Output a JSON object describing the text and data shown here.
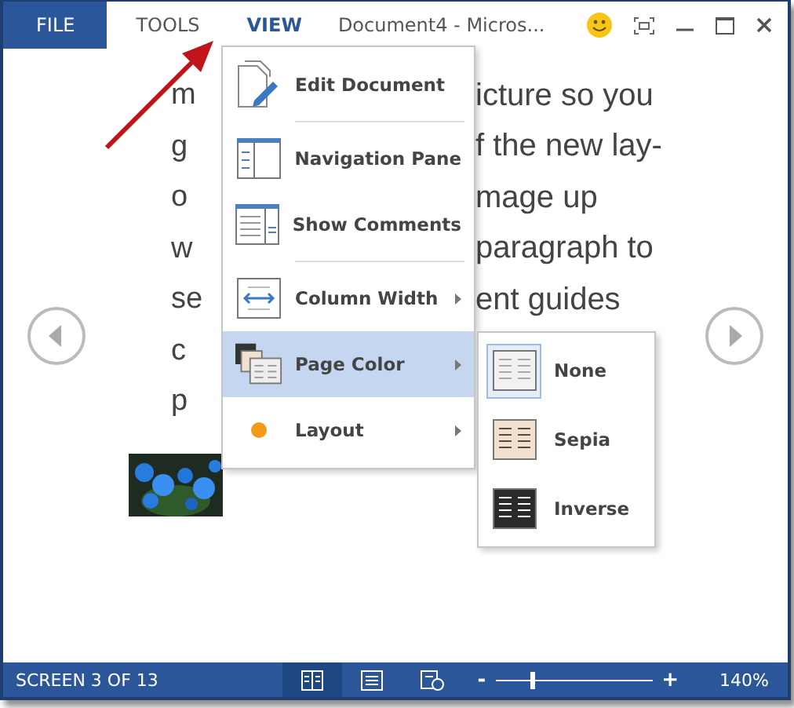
{
  "header": {
    "tabs": [
      {
        "label": "FILE",
        "kind": "file",
        "selected": false
      },
      {
        "label": "TOOLS",
        "kind": "menu",
        "selected": false
      },
      {
        "label": "VIEW",
        "kind": "menu",
        "selected": true
      }
    ],
    "title": "Document4 - Micros..."
  },
  "document": {
    "lines": [
      {
        "left": "m",
        "right": "icture so you"
      },
      {
        "left": "g",
        "right": "f the new lay-"
      },
      {
        "left": "o",
        "right": "mage up"
      },
      {
        "left": "w",
        "right": "paragraph to"
      },
      {
        "left": "se",
        "right": "ent guides"
      },
      {
        "left": "c"
      },
      {
        "left": "p"
      }
    ]
  },
  "view_menu": {
    "items": [
      {
        "label": "Edit Document",
        "kind": "edit",
        "submenu": false,
        "highlighted": false,
        "divider_after": true
      },
      {
        "label": "Navigation Pane",
        "kind": "navigation",
        "submenu": false,
        "highlighted": false,
        "divider_after": false
      },
      {
        "label": "Show Comments",
        "kind": "comments",
        "submenu": false,
        "highlighted": false,
        "divider_after": true
      },
      {
        "label": "Column Width",
        "kind": "column",
        "submenu": true,
        "highlighted": false,
        "divider_after": false
      },
      {
        "label": "Page Color",
        "kind": "pagecolor",
        "submenu": true,
        "highlighted": true,
        "divider_after": false
      },
      {
        "label": "Layout",
        "kind": "layout",
        "submenu": true,
        "highlighted": false,
        "divider_after": false
      }
    ]
  },
  "page_color_submenu": {
    "items": [
      {
        "label": "None",
        "kind": "none",
        "selected": true
      },
      {
        "label": "Sepia",
        "kind": "sepia",
        "selected": false
      },
      {
        "label": "Inverse",
        "kind": "inverse",
        "selected": false
      }
    ]
  },
  "status_bar": {
    "screen": "SCREEN 3 OF 13",
    "views": [
      {
        "kind": "read",
        "selected": true
      },
      {
        "kind": "print",
        "selected": false
      },
      {
        "kind": "web",
        "selected": false
      }
    ],
    "zoom": {
      "minus": "-",
      "plus": "+",
      "level": 0.22,
      "reading": "140%"
    }
  }
}
